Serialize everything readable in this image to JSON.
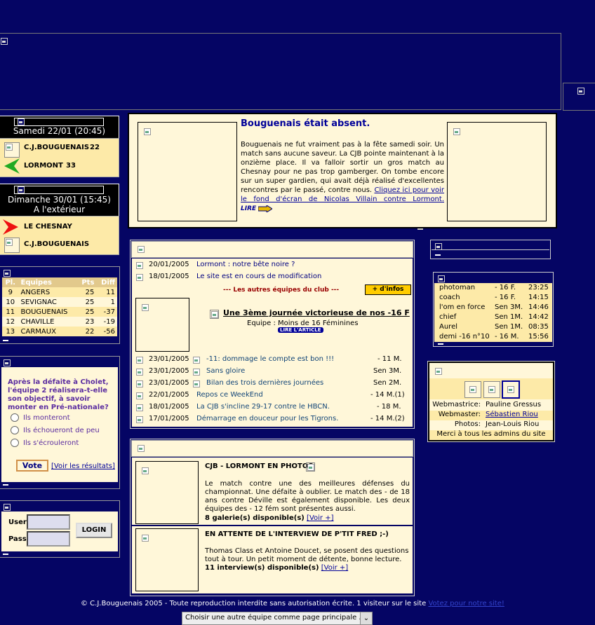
{
  "match_prev": {
    "date": "Samedi 22/01 (20:45)",
    "home_team": "C.J.BOUGUENAIS",
    "home_score": "22",
    "away_team": "LORMONT",
    "away_score": "33"
  },
  "match_next": {
    "date": "Dimanche 30/01 (15:45)",
    "venue": "A l'extérieur",
    "home_team": "LE CHESNAY",
    "away_team": "C.J.BOUGUENAIS"
  },
  "ranking": {
    "headers": [
      "Pl.",
      "Equipes",
      "Pts",
      "Diff"
    ],
    "rows": [
      [
        "9",
        "ANGERS",
        "25",
        "11"
      ],
      [
        "10",
        "SEVIGNAC",
        "25",
        "1"
      ],
      [
        "11",
        "BOUGUENAIS",
        "25",
        "-37"
      ],
      [
        "12",
        "CHAVILLE",
        "23",
        "-19"
      ],
      [
        "13",
        "CARMAUX",
        "22",
        "-56"
      ]
    ]
  },
  "poll": {
    "question": "Après la défaite à Cholet, l'équipe 2 réalisera-t-elle son objectif, à savoir monter en Pré-nationale?",
    "options": [
      "Ils monteront",
      "Ils échoueront de peu",
      "Ils s'écrouleront"
    ],
    "vote_label": "Vote",
    "results_label": "[Voir les résultats]"
  },
  "login": {
    "user_label": "User",
    "pass_label": "Pass",
    "button_label": "LOGIN"
  },
  "headline": {
    "title": "Bouguenais était absent.",
    "body": "Bouguenais ne fut vraiment pas à la fête samedi soir. Un match sans aucune saveur. La CJB pointe maintenant à la onzième place. Il va falloir sortir un gros match au Chesnay pour ne pas trop gamberger. On tombe encore sur un super gardien, qui avait déjà réalisé d'excellentes rencontres par le passé, contre nous.",
    "link": "Cliquez ici pour voir le fond d'écran de Nicolas Villain contre Lormont.",
    "lire": "LIRE"
  },
  "news_top": [
    {
      "date": "20/01/2005",
      "title": "Lormont : notre bête noire ?"
    },
    {
      "date": "18/01/2005",
      "title": "Le site est en cours de modification"
    }
  ],
  "club_teams_label": "--- Les autres équipes du club ---",
  "more_info_label": "+ d'infos",
  "feature": {
    "title": "Une 3ème journée victorieuse de nos -16 F",
    "team": "Equipe : Moins de 16 Féminines",
    "read_label": "LIRE L'ARTICLE"
  },
  "news_list": [
    {
      "date": "23/01/2005",
      "title": "-11: dommage le compte est bon !!!",
      "team": "- 11 M."
    },
    {
      "date": "23/01/2005",
      "title": "Sans gloire",
      "team": "Sen 3M."
    },
    {
      "date": "23/01/2005",
      "title": "Bilan des trois dernières journées",
      "team": "Sen 2M."
    },
    {
      "date": "22/01/2005",
      "title": "Repos ce WeekEnd",
      "team": "- 14 M.(1)"
    },
    {
      "date": "18/01/2005",
      "title": "La CJB s'incline 29-17 contre le HBCN.",
      "team": "- 18 M."
    },
    {
      "date": "17/01/2005",
      "title": "Démarrage en douceur pour les Tigrons.",
      "team": "- 14 M.(2)"
    }
  ],
  "gallery": {
    "title": "CJB - LORMONT EN PHOTOS",
    "body": "Le match contre une des meilleures défenses du championnat. Une défaite à oublier. Le match des - de 18 ans contre Déville est également disponible. Les deux équipes des - 12 fém sont présentes aussi.",
    "count": "8 galerie(s) disponible(s)",
    "more": "[Voir +]"
  },
  "interview": {
    "title": "EN ATTENTE DE L'INTERVIEW DE P'TIT FRED ;-)",
    "body": "Thomas Class et Antoine Doucet, se posent des questions tout à tour. Un petit moment de détente, bonne lecture.",
    "count": "11 interview(s) disponible(s)",
    "more": "[Voir +]"
  },
  "online": [
    [
      "photoman",
      "- 16 F.",
      "23:25"
    ],
    [
      "coach",
      "- 16 F.",
      "14:15"
    ],
    [
      "l'om en force",
      "Sen 3M.",
      "14:46"
    ],
    [
      "chief",
      "Sen 1M.",
      "14:42"
    ],
    [
      "Aurel",
      "Sen 1M.",
      "08:35"
    ],
    [
      "demi -16 n°10",
      "- 16 M.",
      "15:56"
    ]
  ],
  "credits": {
    "rows": [
      [
        "Webmastrice:",
        "Pauline Gressus"
      ],
      [
        "Webmaster:",
        "Sébastien Riou"
      ],
      [
        "Photos:",
        "Jean-Louis Riou"
      ]
    ],
    "thanks": "Merci à tous les admins du site"
  },
  "footer": {
    "text": "© C.J.Bouguenais 2005 - Toute reproduction interdite sans autorisation écrite. 1 visiteur sur le site",
    "vote_link": "Votez pour notre site!",
    "select": "Choisir une autre équipe comme page principale ..."
  },
  "colors": {
    "page_bg": "#050564",
    "cream": "#fff7d9",
    "gold": "#fdeaa8",
    "accent_red": "#990000",
    "more_info_bg": "#ffcc00"
  }
}
